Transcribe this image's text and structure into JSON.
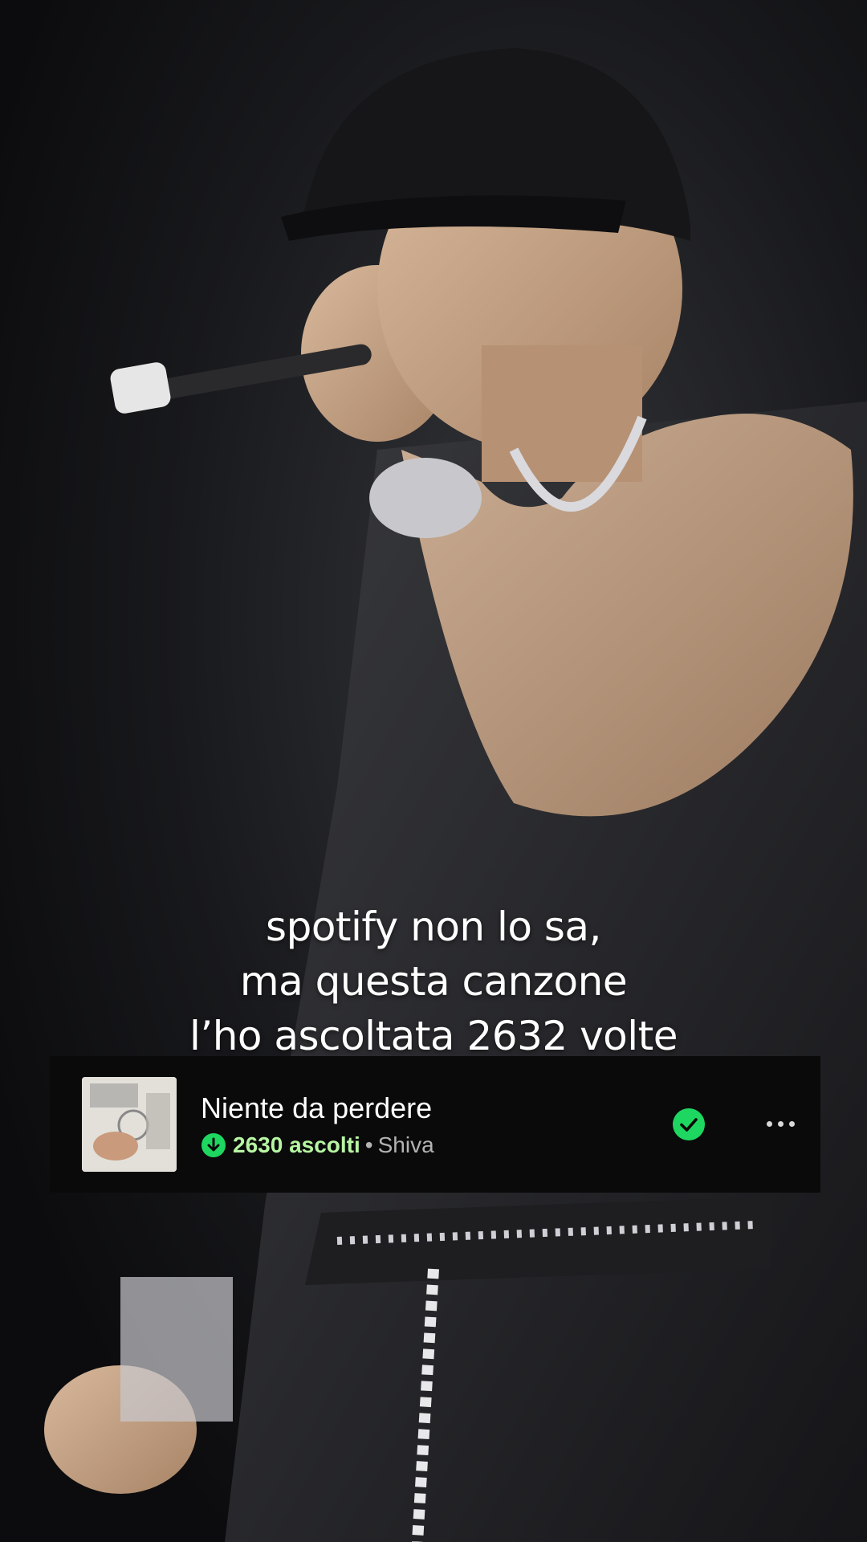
{
  "overlay_caption": {
    "line1": "spotify non lo sa,",
    "line2": "ma questa canzone",
    "line3": "l’ho ascoltata 2632 volte"
  },
  "track": {
    "title": "Niente da perdere",
    "plays": "2630 ascolti",
    "separator": "•",
    "artist": "Shiva"
  },
  "icons": {
    "downloaded": "download-circle-icon",
    "saved": "check-circle-icon",
    "more": "more-options-icon"
  },
  "colors": {
    "accent_green": "#1ed760",
    "plays_text": "#b7f5a2",
    "player_bg": "#0a0a0a"
  }
}
